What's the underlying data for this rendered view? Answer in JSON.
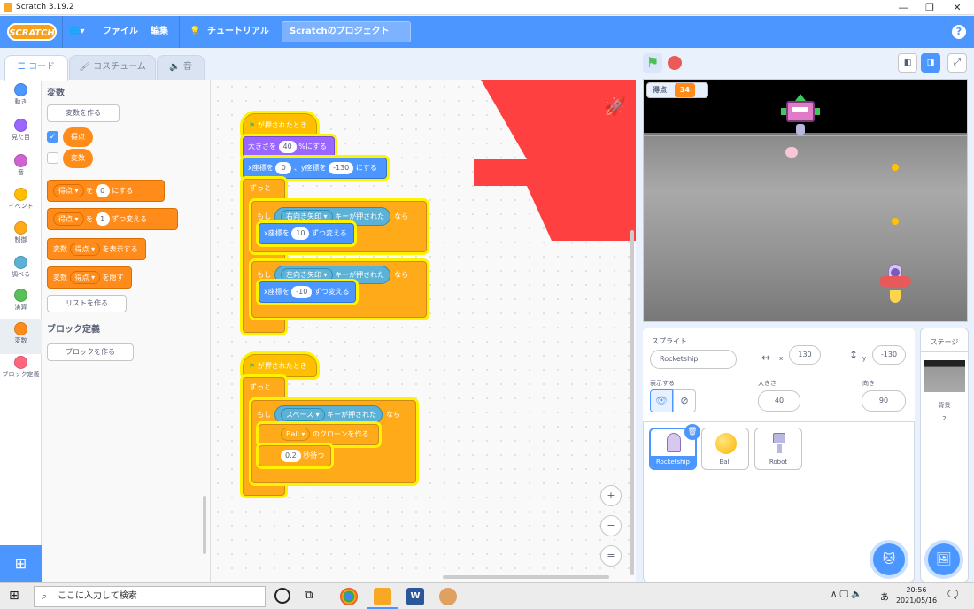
{
  "window": {
    "title": "Scratch 3.19.2",
    "minimize": "—",
    "maximize": "❐",
    "close": "✕"
  },
  "menu": {
    "logo": "SCRATCH",
    "language_icon": "🌐▾",
    "file": "ファイル",
    "edit": "編集",
    "tutorial": "チュートリアル",
    "project_name": "Scratchのプロジェクト",
    "help": "?"
  },
  "tabs": {
    "code": "コード",
    "costumes": "コスチューム",
    "sounds": "音"
  },
  "categories": [
    {
      "label": "動き",
      "color": "#4c97ff"
    },
    {
      "label": "見た目",
      "color": "#9966ff"
    },
    {
      "label": "音",
      "color": "#cf63cf"
    },
    {
      "label": "イベント",
      "color": "#ffbf00"
    },
    {
      "label": "制御",
      "color": "#ffab19"
    },
    {
      "label": "調べる",
      "color": "#5cb1d6"
    },
    {
      "label": "演算",
      "color": "#59c059"
    },
    {
      "label": "変数",
      "color": "#ff8c1a"
    },
    {
      "label": "ブロック定義",
      "color": "#ff6680"
    }
  ],
  "palette": {
    "heading": "変数",
    "make_variable": "変数を作る",
    "var1": "得点",
    "var2": "変数",
    "set_var": "得点",
    "set_to": "を",
    "set_val": "0",
    "set_end": "にする",
    "change_var": "得点",
    "change_by": "を",
    "change_val": "1",
    "change_end": "ずつ変える",
    "show_prefix": "変数",
    "show_var": "得点",
    "show_end": "を表示する",
    "hide_prefix": "変数",
    "hide_var": "得点",
    "hide_end": "を隠す",
    "make_list": "リストを作る",
    "myblocks_heading": "ブロック定義",
    "make_block": "ブロックを作る"
  },
  "script1": {
    "hat": "が押されたとき",
    "size_pre": "大きさを",
    "size_val": "40",
    "size_post": "%にする",
    "goto_x": "x座標を",
    "goto_xv": "0",
    "goto_y": "、y座標を",
    "goto_yv": "-130",
    "goto_post": "にする",
    "forever": "ずっと",
    "if1": "もし",
    "if1_key": "右向き矢印 ▾",
    "if1_q": "キーが押された",
    "if1_then": "なら",
    "chx1": "x座標を",
    "chx1_v": "10",
    "chx1_post": "ずつ変える",
    "if2": "もし",
    "if2_key": "左向き矢印 ▾",
    "if2_q": "キーが押された",
    "if2_then": "なら",
    "chx2": "x座標を",
    "chx2_v": "-10",
    "chx2_post": "ずつ変える",
    "loop_arrow": "↻"
  },
  "script2": {
    "hat": "が押されたとき",
    "forever": "ずっと",
    "if": "もし",
    "key": "スペース ▾",
    "q": "キーが押された",
    "then": "なら",
    "clone_target": "Ball ▾",
    "clone_post": "のクローンを作る",
    "wait_v": "0.2",
    "wait_post": "秒待つ",
    "loop_arrow": "↻"
  },
  "zoom": {
    "in": "+",
    "out": "−",
    "reset": "="
  },
  "stage": {
    "monitor_label": "得点",
    "monitor_value": "34"
  },
  "sprite_info": {
    "heading": "スプライト",
    "name": "Rocketship",
    "x_label": "x",
    "x": "130",
    "y_label": "y",
    "y": "-130",
    "show_label": "表示する",
    "size_label": "大きさ",
    "size": "40",
    "direction_label": "向き",
    "direction": "90"
  },
  "sprites": [
    {
      "name": "Rocketship"
    },
    {
      "name": "Ball"
    },
    {
      "name": "Robot"
    }
  ],
  "stage_pane": {
    "heading": "ステージ",
    "backdrops_label": "背景",
    "backdrops_count": "2"
  },
  "taskbar": {
    "search_placeholder": "ここに入力して検索",
    "time": "20:56",
    "date": "2021/05/16",
    "ime": "あ"
  }
}
